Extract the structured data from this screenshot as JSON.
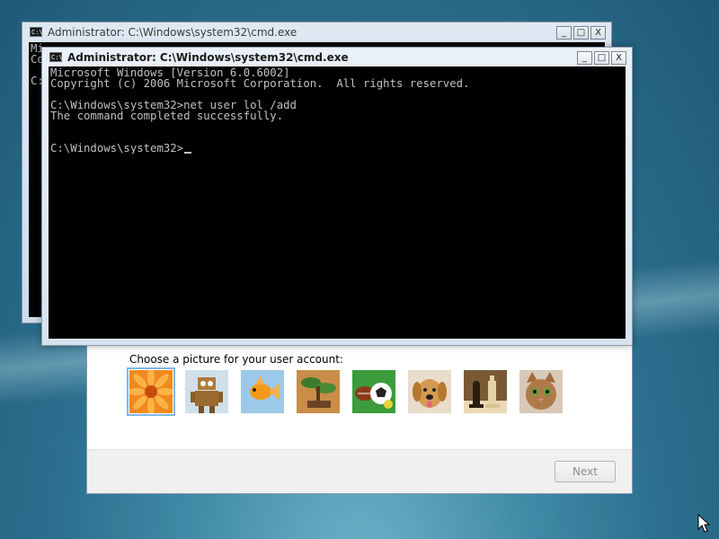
{
  "wizard": {
    "picture_label": "Choose a picture for your user account:",
    "pictures": [
      {
        "name": "flower-icon"
      },
      {
        "name": "robot-icon"
      },
      {
        "name": "goldfish-icon"
      },
      {
        "name": "bonsai-icon"
      },
      {
        "name": "sports-balls-icon"
      },
      {
        "name": "puppy-icon"
      },
      {
        "name": "chess-icon"
      },
      {
        "name": "kitten-icon"
      }
    ],
    "next_label": "Next"
  },
  "back_window": {
    "title": "Administrator: C:\\Windows\\system32\\cmd.exe",
    "console_lines": [
      "Mi",
      "Co",
      "",
      "C:"
    ]
  },
  "front_window": {
    "title": "Administrator: C:\\Windows\\system32\\cmd.exe",
    "console_lines": [
      "Microsoft Windows [Version 6.0.6002]",
      "Copyright (c) 2006 Microsoft Corporation.  All rights reserved.",
      "",
      "C:\\Windows\\system32>net user lol /add",
      "The command completed successfully.",
      "",
      "",
      "C:\\Windows\\system32>"
    ]
  },
  "caption_buttons": {
    "minimize": "_",
    "maximize": "□",
    "close": "X"
  },
  "icon_label": "C:\\"
}
